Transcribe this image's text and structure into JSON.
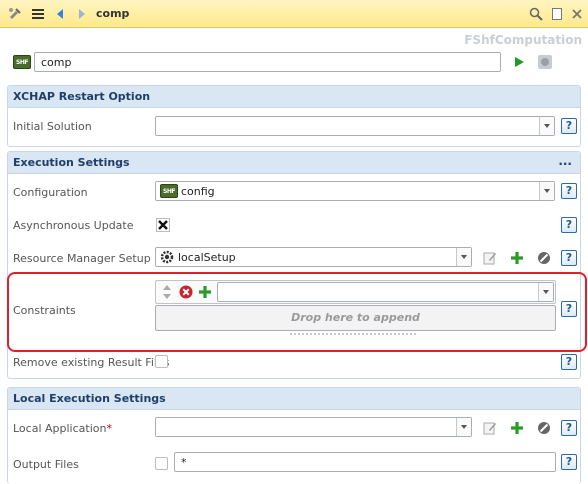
{
  "toolbar": {
    "title": "comp",
    "icons": [
      "satellite-icon",
      "menu-icon",
      "back-arrow-icon",
      "forward-arrow-icon",
      "search-icon",
      "copy-icon",
      "close-icon"
    ]
  },
  "class_name": "FShfComputation",
  "name_field": {
    "badge": "SHF",
    "value": "comp"
  },
  "sections": {
    "xchap": {
      "title": "XCHAP Restart Option",
      "initial_solution_label": "Initial Solution",
      "initial_solution_value": ""
    },
    "execution": {
      "title": "Execution Settings",
      "more": "...",
      "configuration_label": "Configuration",
      "configuration_value": "config",
      "configuration_badge": "SHF",
      "async_label": "Asynchronous Update",
      "async_checked": true,
      "resource_label": "Resource Manager Setup",
      "resource_value": "localSetup",
      "constraints_label": "Constraints",
      "constraints_value": "",
      "drop_text": "Drop here to append",
      "remove_label": "Remove existing Result Files",
      "remove_checked": false
    },
    "local": {
      "title": "Local Execution Settings",
      "app_label": "Local Application",
      "app_required": "*",
      "app_value": "",
      "output_label": "Output Files",
      "output_checked": false,
      "output_value": "*"
    }
  },
  "help_label": "?",
  "colors": {
    "toolbar": "#ffe98a",
    "section_header": "#d9e6f3",
    "highlight": "#e0202a",
    "add_green": "#2a9a2a"
  }
}
